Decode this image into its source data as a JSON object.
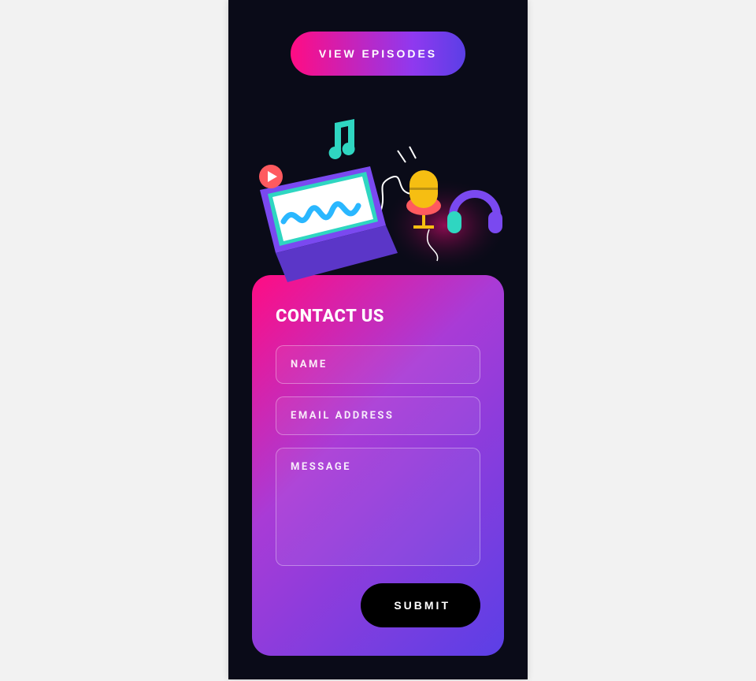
{
  "header": {
    "view_episodes_label": "VIEW EPISODES"
  },
  "illustration": {
    "icons": [
      "music-note-icon",
      "play-icon",
      "laptop-icon",
      "waveform-icon",
      "microphone-icon",
      "headphones-icon"
    ],
    "colors": {
      "purple": "#7a49f0",
      "teal": "#2fd6c1",
      "cyan": "#2ab7ff",
      "pink": "#ff5a5f",
      "orange": "#f6be12",
      "glowPink": "#ff0c83"
    }
  },
  "contact": {
    "title": "CONTACT US",
    "fields": {
      "name_placeholder": "NAME",
      "email_placeholder": "EMAIL ADDRESS",
      "message_placeholder": "MESSAGE"
    },
    "submit_label": "SUBMIT"
  }
}
